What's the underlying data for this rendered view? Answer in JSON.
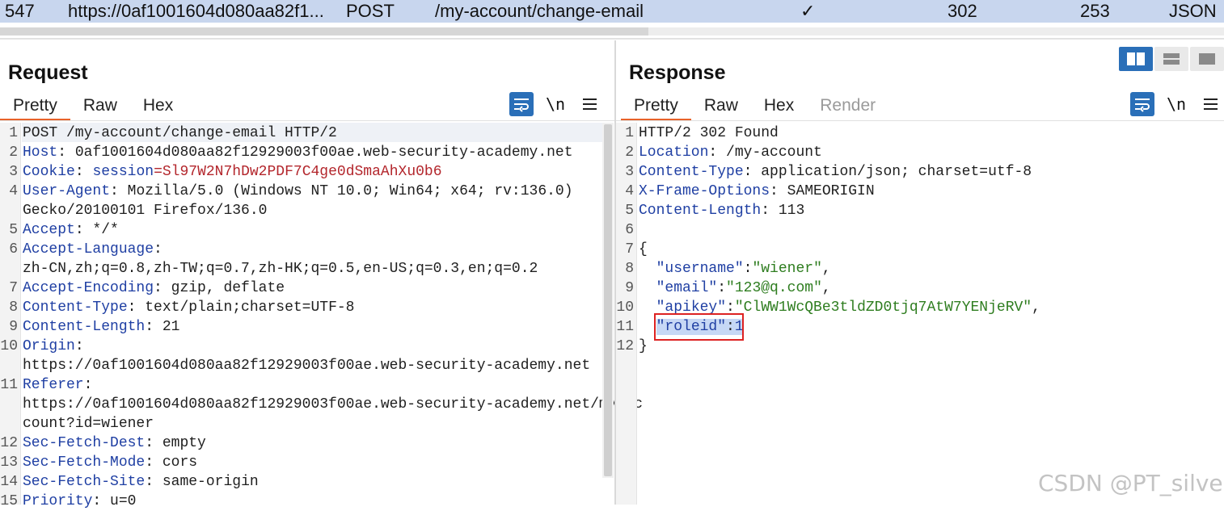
{
  "history_row": {
    "id": "547",
    "host": "https://0af1001604d080aa82f1...",
    "method": "POST",
    "url": "/my-account/change-email",
    "params_check": "✓",
    "status": "302",
    "length": "253",
    "mime": "JSON"
  },
  "request": {
    "title": "Request",
    "tabs": [
      "Pretty",
      "Raw",
      "Hex"
    ],
    "active_tab": "Pretty",
    "tool_newline": "\\n",
    "lines": [
      {
        "n": "1",
        "key": "POST /my-account/change-email HTTP/2",
        "sep": "",
        "val": ""
      },
      {
        "n": "2",
        "key": "Host",
        "sep": ":",
        "val": " 0af1001604d080aa82f12929003f00ae.web-security-academy.net"
      },
      {
        "n": "3",
        "key": "Cookie",
        "sep": ":",
        "val": " ",
        "extra_key": "session",
        "extra_val": "=Sl97W2N7hDw2PDF7C4ge0dSmaAhXu0b6"
      },
      {
        "n": "4",
        "key": "User-Agent",
        "sep": ":",
        "val": " Mozilla/5.0 (Windows NT 10.0; Win64; x64; rv:136.0)"
      },
      {
        "n": "",
        "key": "",
        "sep": "",
        "val": "Gecko/20100101 Firefox/136.0"
      },
      {
        "n": "5",
        "key": "Accept",
        "sep": ":",
        "val": " */*"
      },
      {
        "n": "6",
        "key": "Accept-Language",
        "sep": ":",
        "val": ""
      },
      {
        "n": "",
        "key": "",
        "sep": "",
        "val": "zh-CN,zh;q=0.8,zh-TW;q=0.7,zh-HK;q=0.5,en-US;q=0.3,en;q=0.2"
      },
      {
        "n": "7",
        "key": "Accept-Encoding",
        "sep": ":",
        "val": " gzip, deflate"
      },
      {
        "n": "8",
        "key": "Content-Type",
        "sep": ":",
        "val": " text/plain;charset=UTF-8"
      },
      {
        "n": "9",
        "key": "Content-Length",
        "sep": ":",
        "val": " 21"
      },
      {
        "n": "10",
        "key": "Origin",
        "sep": ":",
        "val": ""
      },
      {
        "n": "",
        "key": "",
        "sep": "",
        "val": "https://0af1001604d080aa82f12929003f00ae.web-security-academy.net"
      },
      {
        "n": "11",
        "key": "Referer",
        "sep": ":",
        "val": ""
      },
      {
        "n": "",
        "key": "",
        "sep": "",
        "val": "https://0af1001604d080aa82f12929003f00ae.web-security-academy.net/my-ac"
      },
      {
        "n": "",
        "key": "",
        "sep": "",
        "val": "count?id=wiener"
      },
      {
        "n": "12",
        "key": "Sec-Fetch-Dest",
        "sep": ":",
        "val": " empty"
      },
      {
        "n": "13",
        "key": "Sec-Fetch-Mode",
        "sep": ":",
        "val": " cors"
      },
      {
        "n": "14",
        "key": "Sec-Fetch-Site",
        "sep": ":",
        "val": " same-origin"
      },
      {
        "n": "15",
        "key": "Priority",
        "sep": ":",
        "val": " u=0"
      }
    ]
  },
  "response": {
    "title": "Response",
    "tabs": [
      "Pretty",
      "Raw",
      "Hex",
      "Render"
    ],
    "active_tab": "Pretty",
    "tool_newline": "\\n",
    "lines": [
      {
        "n": "1",
        "text": "HTTP/2 302 Found"
      },
      {
        "n": "2",
        "key": "Location",
        "val": " /my-account"
      },
      {
        "n": "3",
        "key": "Content-Type",
        "val": " application/json; charset=utf-8"
      },
      {
        "n": "4",
        "key": "X-Frame-Options",
        "val": " SAMEORIGIN"
      },
      {
        "n": "5",
        "key": "Content-Length",
        "val": " 113"
      },
      {
        "n": "6",
        "text": ""
      },
      {
        "n": "7",
        "text": "{"
      },
      {
        "n": "8",
        "jkey": "\"username\"",
        "jval": "\"wiener\"",
        "comma": ","
      },
      {
        "n": "9",
        "jkey": "\"email\"",
        "jval": "\"123@q.com\"",
        "comma": ","
      },
      {
        "n": "10",
        "jkey": "\"apikey\"",
        "jval": "\"ClWW1WcQBe3tldZD0tjq7AtW7YENjeRV\"",
        "comma": ","
      },
      {
        "n": "11",
        "jkey": "\"roleid\"",
        "jnum": "1",
        "comma": "",
        "highlight": true
      },
      {
        "n": "12",
        "text": "}"
      }
    ]
  },
  "watermark": "CSDN @PT_silver"
}
